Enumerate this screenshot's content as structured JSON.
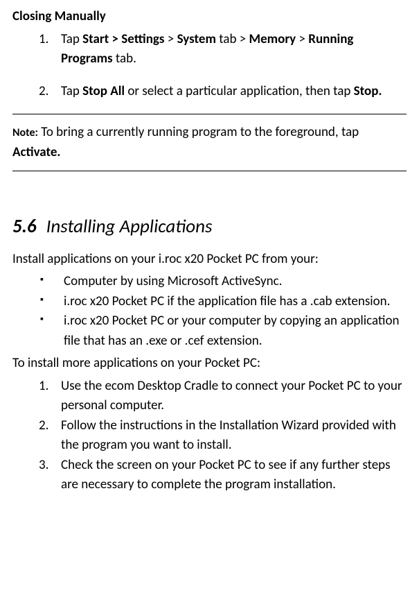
{
  "closing": {
    "heading": "Closing Manually",
    "steps": [
      {
        "num": "1.",
        "parts": [
          {
            "text": "Tap ",
            "bold": false
          },
          {
            "text": "Start > Settings",
            "bold": true
          },
          {
            "text": " > ",
            "bold": false
          },
          {
            "text": "System",
            "bold": true
          },
          {
            "text": " tab > ",
            "bold": false
          },
          {
            "text": "Memory",
            "bold": true
          },
          {
            "text": " > ",
            "bold": false
          },
          {
            "text": "Running Programs",
            "bold": true
          },
          {
            "text": " tab.",
            "bold": false
          }
        ]
      },
      {
        "num": "2.",
        "parts": [
          {
            "text": "Tap ",
            "bold": false
          },
          {
            "text": "Stop All",
            "bold": true
          },
          {
            "text": " or select a particular application, then tap ",
            "bold": false
          },
          {
            "text": "Stop.",
            "bold": true
          }
        ]
      }
    ]
  },
  "note": {
    "label": "Note:",
    "parts": [
      {
        "text": " To bring a currently running program to the foreground, tap ",
        "bold": false
      },
      {
        "text": "Activate.",
        "bold": true
      }
    ]
  },
  "section": {
    "number": "5.6",
    "title": "Installing Applications",
    "intro": "Install applications on your i.roc x20 Pocket PC from your:",
    "bullets": [
      "Computer by using Microsoft ActiveSync.",
      "i.roc x20 Pocket PC if the application file has a .cab extension.",
      "i.roc x20 Pocket PC or your computer by copying an application file that has an .exe or .cef extension."
    ],
    "follow": "To install more applications on your Pocket PC:",
    "steps": [
      {
        "num": "1.",
        "text": "Use the ecom Desktop Cradle to connect your Pocket PC to your personal computer."
      },
      {
        "num": "2.",
        "text": "Follow the instructions in the Installation Wizard provided with the program you want to install."
      },
      {
        "num": "3.",
        "text": "Check the screen on your Pocket PC to see if any further steps are necessary to complete the program installation."
      }
    ]
  }
}
